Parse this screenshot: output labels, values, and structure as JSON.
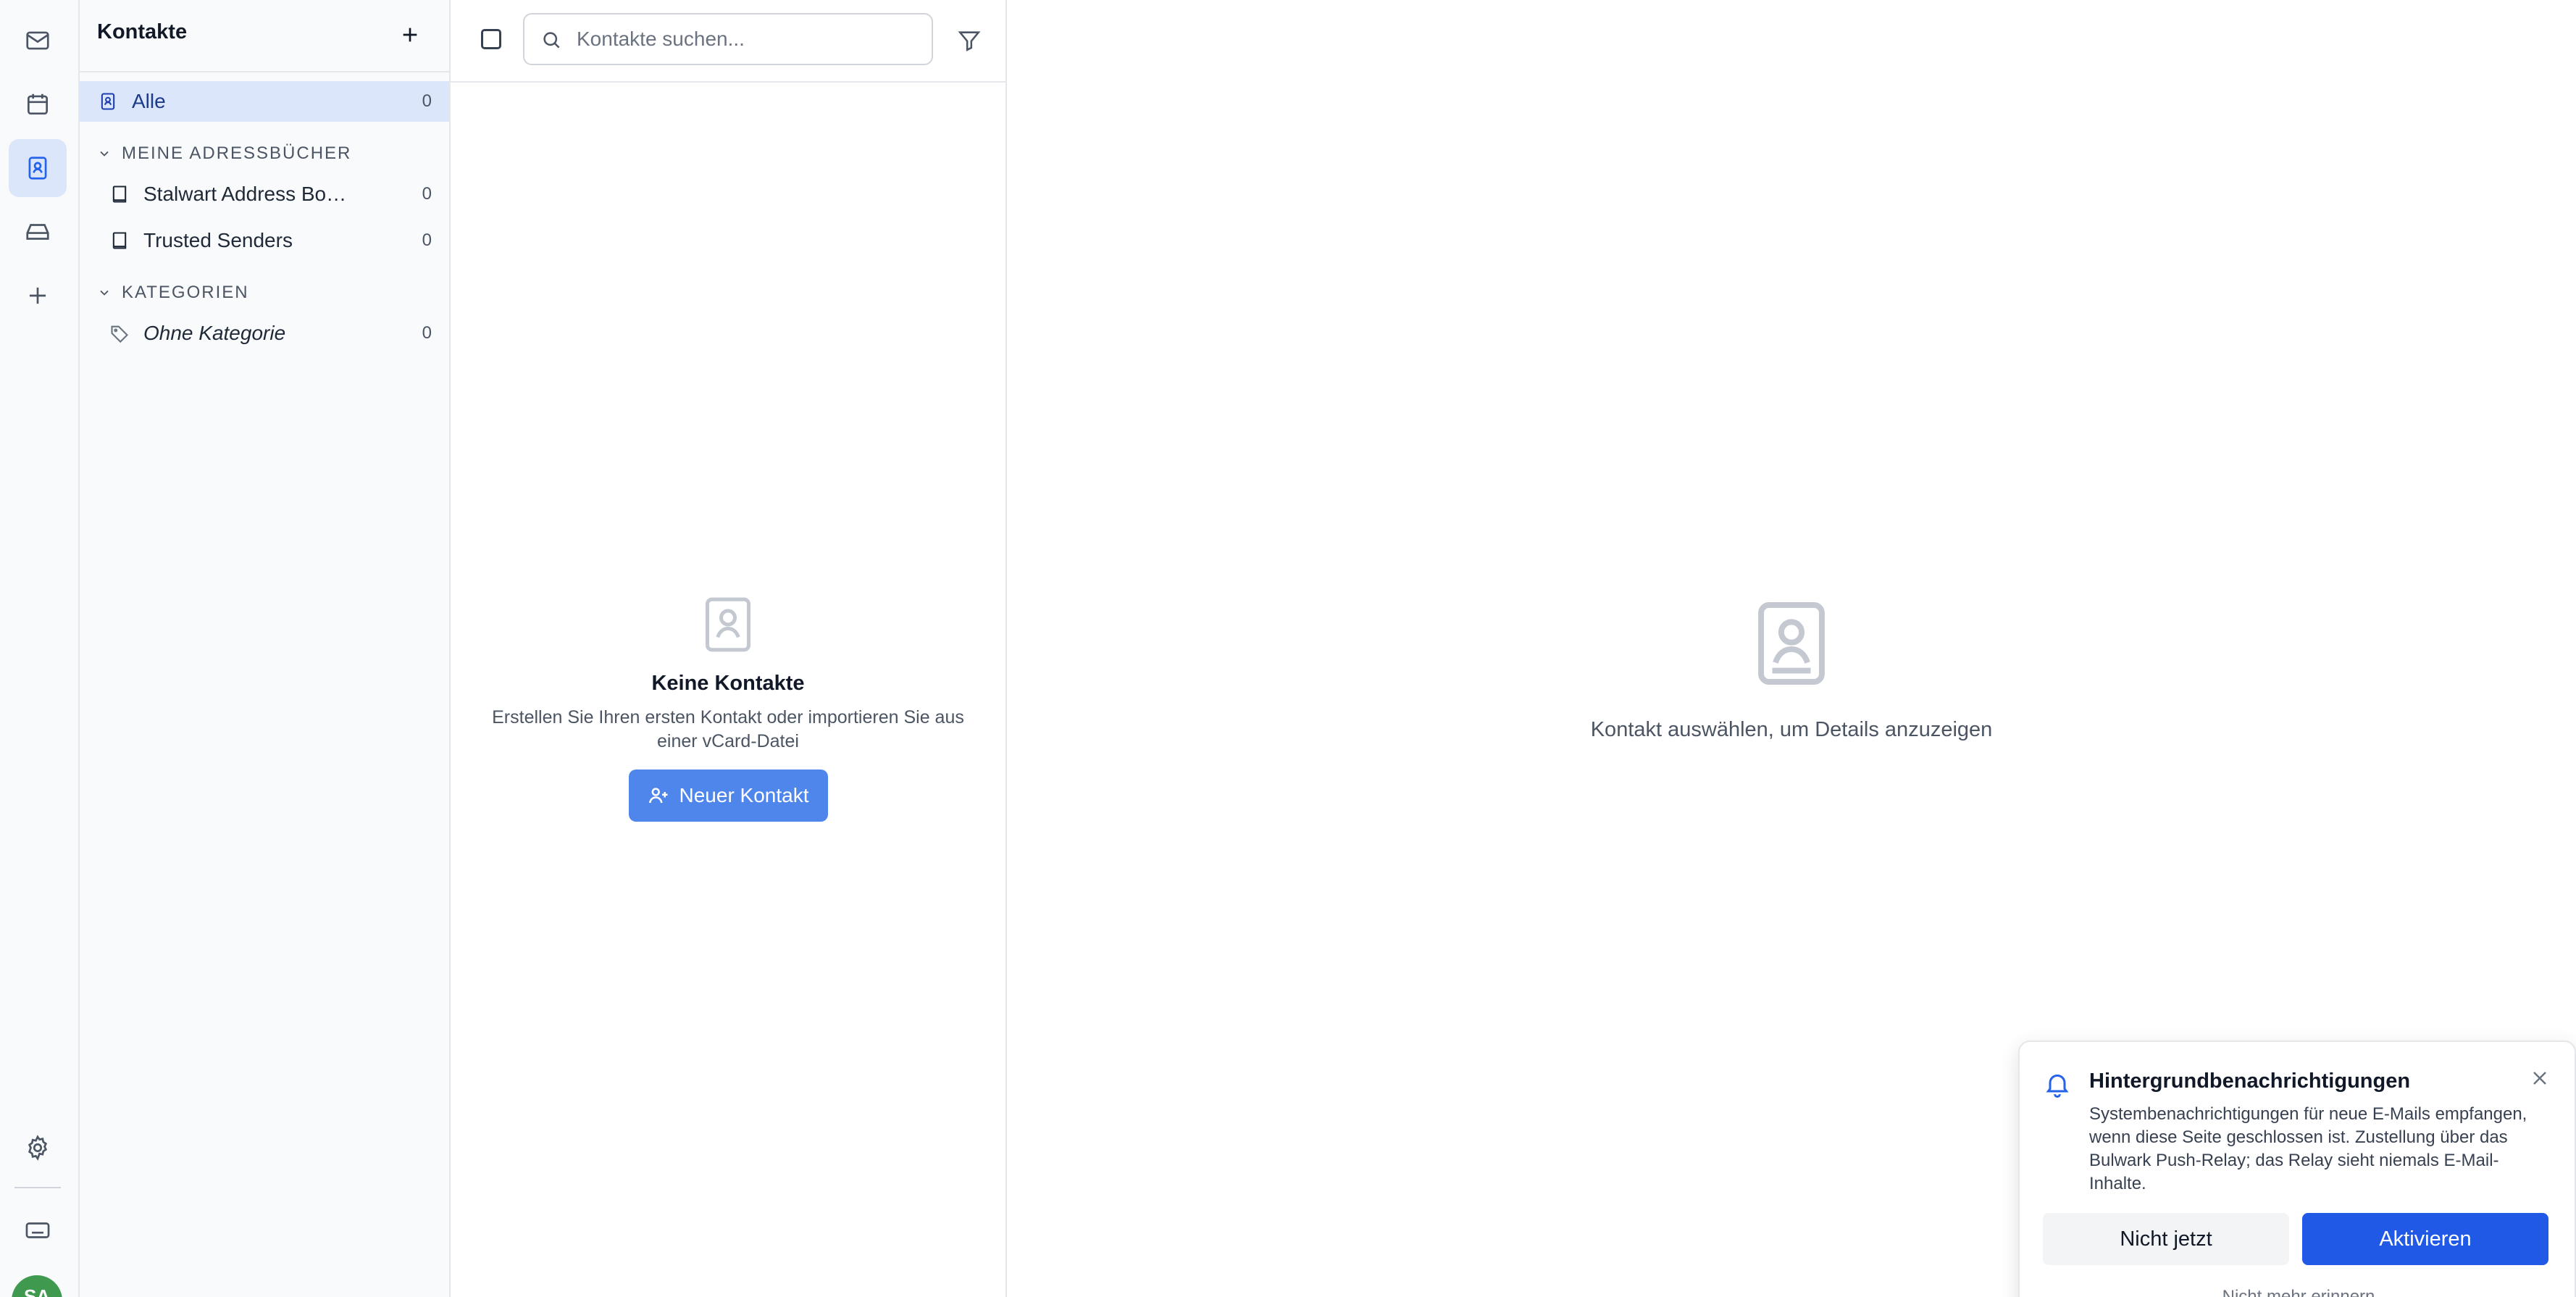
{
  "rail": {
    "items": [
      {
        "icon": "mail-icon",
        "active": false
      },
      {
        "icon": "calendar-icon",
        "active": false
      },
      {
        "icon": "contacts-icon",
        "active": true
      },
      {
        "icon": "drive-icon",
        "active": false
      },
      {
        "icon": "plus-icon",
        "active": false
      }
    ],
    "avatar_initials": "SA"
  },
  "sidebar": {
    "title": "Kontakte",
    "all": {
      "label": "Alle",
      "count": "0"
    },
    "sections": [
      {
        "title": "MEINE ADRESSBÜCHER",
        "items": [
          {
            "label": "Stalwart Address Book (admin)",
            "count": "0"
          },
          {
            "label": "Trusted Senders",
            "count": "0"
          }
        ]
      },
      {
        "title": "KATEGORIEN",
        "items": [
          {
            "label": "Ohne Kategorie",
            "count": "0"
          }
        ]
      }
    ]
  },
  "list": {
    "search_placeholder": "Kontakte suchen...",
    "empty_title": "Keine Kontakte",
    "empty_text": "Erstellen Sie Ihren ersten Kontakt oder importieren Sie aus einer vCard-Datei",
    "new_contact_label": "Neuer Kontakt"
  },
  "detail": {
    "empty_text": "Kontakt auswählen, um Details anzuzeigen"
  },
  "notification": {
    "title": "Hintergrundbenachrichtigungen",
    "message": "Systembenachrichtigungen für neue E-Mails empfangen, wenn diese Seite geschlossen ist. Zustellung über das Bulwark Push-Relay; das Relay sieht niemals E-Mail-Inhalte.",
    "later_label": "Nicht jetzt",
    "activate_label": "Aktivieren",
    "dismiss_label": "Nicht mehr erinnern"
  },
  "colors": {
    "accent": "#1f59e6",
    "accent_light": "#4f86eb",
    "active_bg": "#dbe6fb",
    "avatar": "#3f9a4f"
  }
}
